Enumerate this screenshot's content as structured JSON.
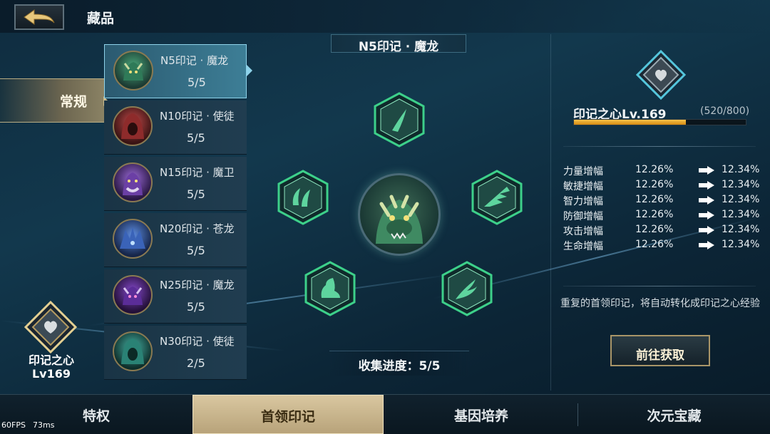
{
  "header": {
    "title": "藏品"
  },
  "category_tab": {
    "label": "常规"
  },
  "boss_list": [
    {
      "name": "N5印记 · 魔龙",
      "progress": "5/5",
      "portrait_color": "#3d8a63"
    },
    {
      "name": "N10印记 · 使徒",
      "progress": "5/5",
      "portrait_color": "#a33a3a"
    },
    {
      "name": "N15印记 · 魔卫",
      "progress": "5/5",
      "portrait_color": "#7b4fb8"
    },
    {
      "name": "N20印记 · 苍龙",
      "progress": "5/5",
      "portrait_color": "#3e63b5"
    },
    {
      "name": "N25印记 · 魔龙",
      "progress": "5/5",
      "portrait_color": "#6b3ab0"
    },
    {
      "name": "N30印记 · 使徒",
      "progress": "2/5",
      "portrait_color": "#2f8f84"
    }
  ],
  "heart": {
    "label_line1": "印记之心",
    "label_line2": "Lv169"
  },
  "center": {
    "title": "N5印记 · 魔龙",
    "collect_label": "收集进度：5/5",
    "slots": [
      "horn-icon",
      "claw-icon",
      "wing-icon",
      "foot-icon",
      "tail-icon"
    ]
  },
  "right_panel": {
    "title": "印记之心Lv.169",
    "exp_text": "(520/800)",
    "exp_fraction": 0.65,
    "stats": [
      {
        "name": "力量增幅",
        "current": "12.26%",
        "next": "12.34%"
      },
      {
        "name": "敏捷增幅",
        "current": "12.26%",
        "next": "12.34%"
      },
      {
        "name": "智力增幅",
        "current": "12.26%",
        "next": "12.34%"
      },
      {
        "name": "防御增幅",
        "current": "12.26%",
        "next": "12.34%"
      },
      {
        "name": "攻击增幅",
        "current": "12.26%",
        "next": "12.34%"
      },
      {
        "name": "生命增幅",
        "current": "12.26%",
        "next": "12.34%"
      }
    ],
    "note": "重复的首领印记，将自动转化成印记之心经验",
    "button_label": "前往获取"
  },
  "bottom_nav": [
    {
      "label": "特权",
      "active": false
    },
    {
      "label": "首领印记",
      "active": true
    },
    {
      "label": "基因培养",
      "active": false
    },
    {
      "label": "次元宝藏",
      "active": false
    }
  ],
  "debug": {
    "fps": "60FPS",
    "ms": "73ms"
  },
  "colors": {
    "accent_gold": "#d9c7a0",
    "hex_green": "#3dd08a",
    "exp_bar": "#f6c24a"
  }
}
